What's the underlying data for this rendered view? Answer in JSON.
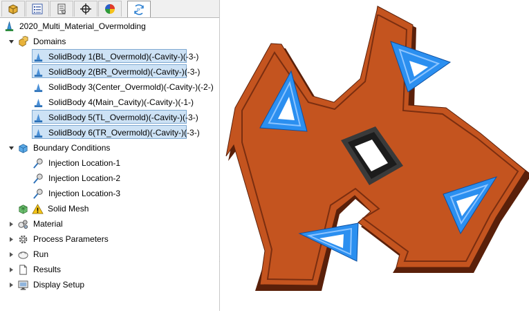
{
  "tabs": [
    {
      "icon": "feature-manager-icon"
    },
    {
      "icon": "property-manager-icon"
    },
    {
      "icon": "configuration-manager-icon"
    },
    {
      "icon": "dimxpert-icon"
    },
    {
      "icon": "display-manager-icon"
    },
    {
      "icon": "plastics-manager-icon",
      "active": true
    }
  ],
  "tree": {
    "root": {
      "label": "2020_Multi_Material_Overmolding"
    },
    "domains": {
      "label": "Domains",
      "items": [
        {
          "label": "SolidBody 1(BL_Overmold)(-Cavity-)(-3-)",
          "selected": true
        },
        {
          "label": "SolidBody 2(BR_Overmold)(-Cavity-)(-3-)",
          "selected": true
        },
        {
          "label": "SolidBody 3(Center_Overmold)(-Cavity-)(-2-)",
          "selected": false
        },
        {
          "label": "SolidBody 4(Main_Cavity)(-Cavity-)(-1-)",
          "selected": false
        },
        {
          "label": "SolidBody 5(TL_Overmold)(-Cavity-)(-3-)",
          "selected": true
        },
        {
          "label": "SolidBody 6(TR_Overmold)(-Cavity-)(-3-)",
          "selected": true
        }
      ]
    },
    "boundary": {
      "label": "Boundary Conditions",
      "items": [
        {
          "label": "Injection Location-1"
        },
        {
          "label": "Injection Location-2"
        },
        {
          "label": "Injection Location-3"
        }
      ]
    },
    "solid_mesh": {
      "label": "Solid Mesh"
    },
    "material": {
      "label": "Material"
    },
    "process": {
      "label": "Process Parameters"
    },
    "run": {
      "label": "Run"
    },
    "results": {
      "label": "Results"
    },
    "display": {
      "label": "Display Setup"
    }
  },
  "colors": {
    "part_body": "#c4541f",
    "part_edge": "#5a200a",
    "overmold_blue": "#2b8ff0",
    "center_overmold": "#2a2a2a",
    "selection_fill": "#cde2f5",
    "selection_border": "#7fa9d1"
  }
}
